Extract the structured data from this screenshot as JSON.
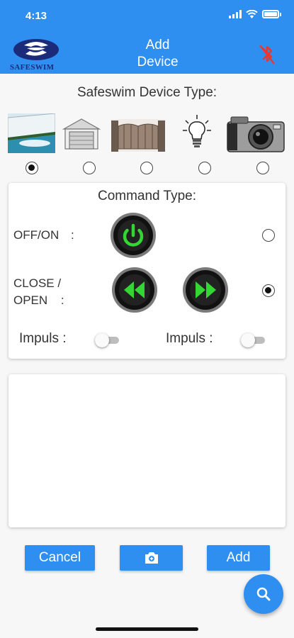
{
  "status_bar": {
    "time": "4:13"
  },
  "header": {
    "logo_text": "SAFESWIM",
    "title_line1": "Add",
    "title_line2": "Device",
    "bluetooth_status": "bluetooth-disabled-icon"
  },
  "device_type": {
    "label": "Safeswim Device Type:",
    "options": [
      {
        "icon": "pool-cover-icon",
        "selected": true
      },
      {
        "icon": "garage-door-icon",
        "selected": false
      },
      {
        "icon": "gate-icon",
        "selected": false
      },
      {
        "icon": "light-bulb-icon",
        "selected": false
      },
      {
        "icon": "camera-icon",
        "selected": false
      }
    ]
  },
  "command_type": {
    "label": "Command Type:",
    "off_on": {
      "label": "OFF/ON",
      "separator": ":",
      "selected": false
    },
    "close_open": {
      "label_line1": "CLOSE /",
      "label_line2": "OPEN",
      "separator": ":",
      "selected": true
    },
    "impuls_left": {
      "label": "Impuls :",
      "on": false
    },
    "impuls_right": {
      "label": "Impuls :",
      "on": false
    }
  },
  "actions": {
    "cancel_label": "Cancel",
    "add_label": "Add"
  },
  "colors": {
    "primary": "#2f8ff0",
    "bluetooth_off": "#e53935",
    "button_green": "#33d633"
  }
}
